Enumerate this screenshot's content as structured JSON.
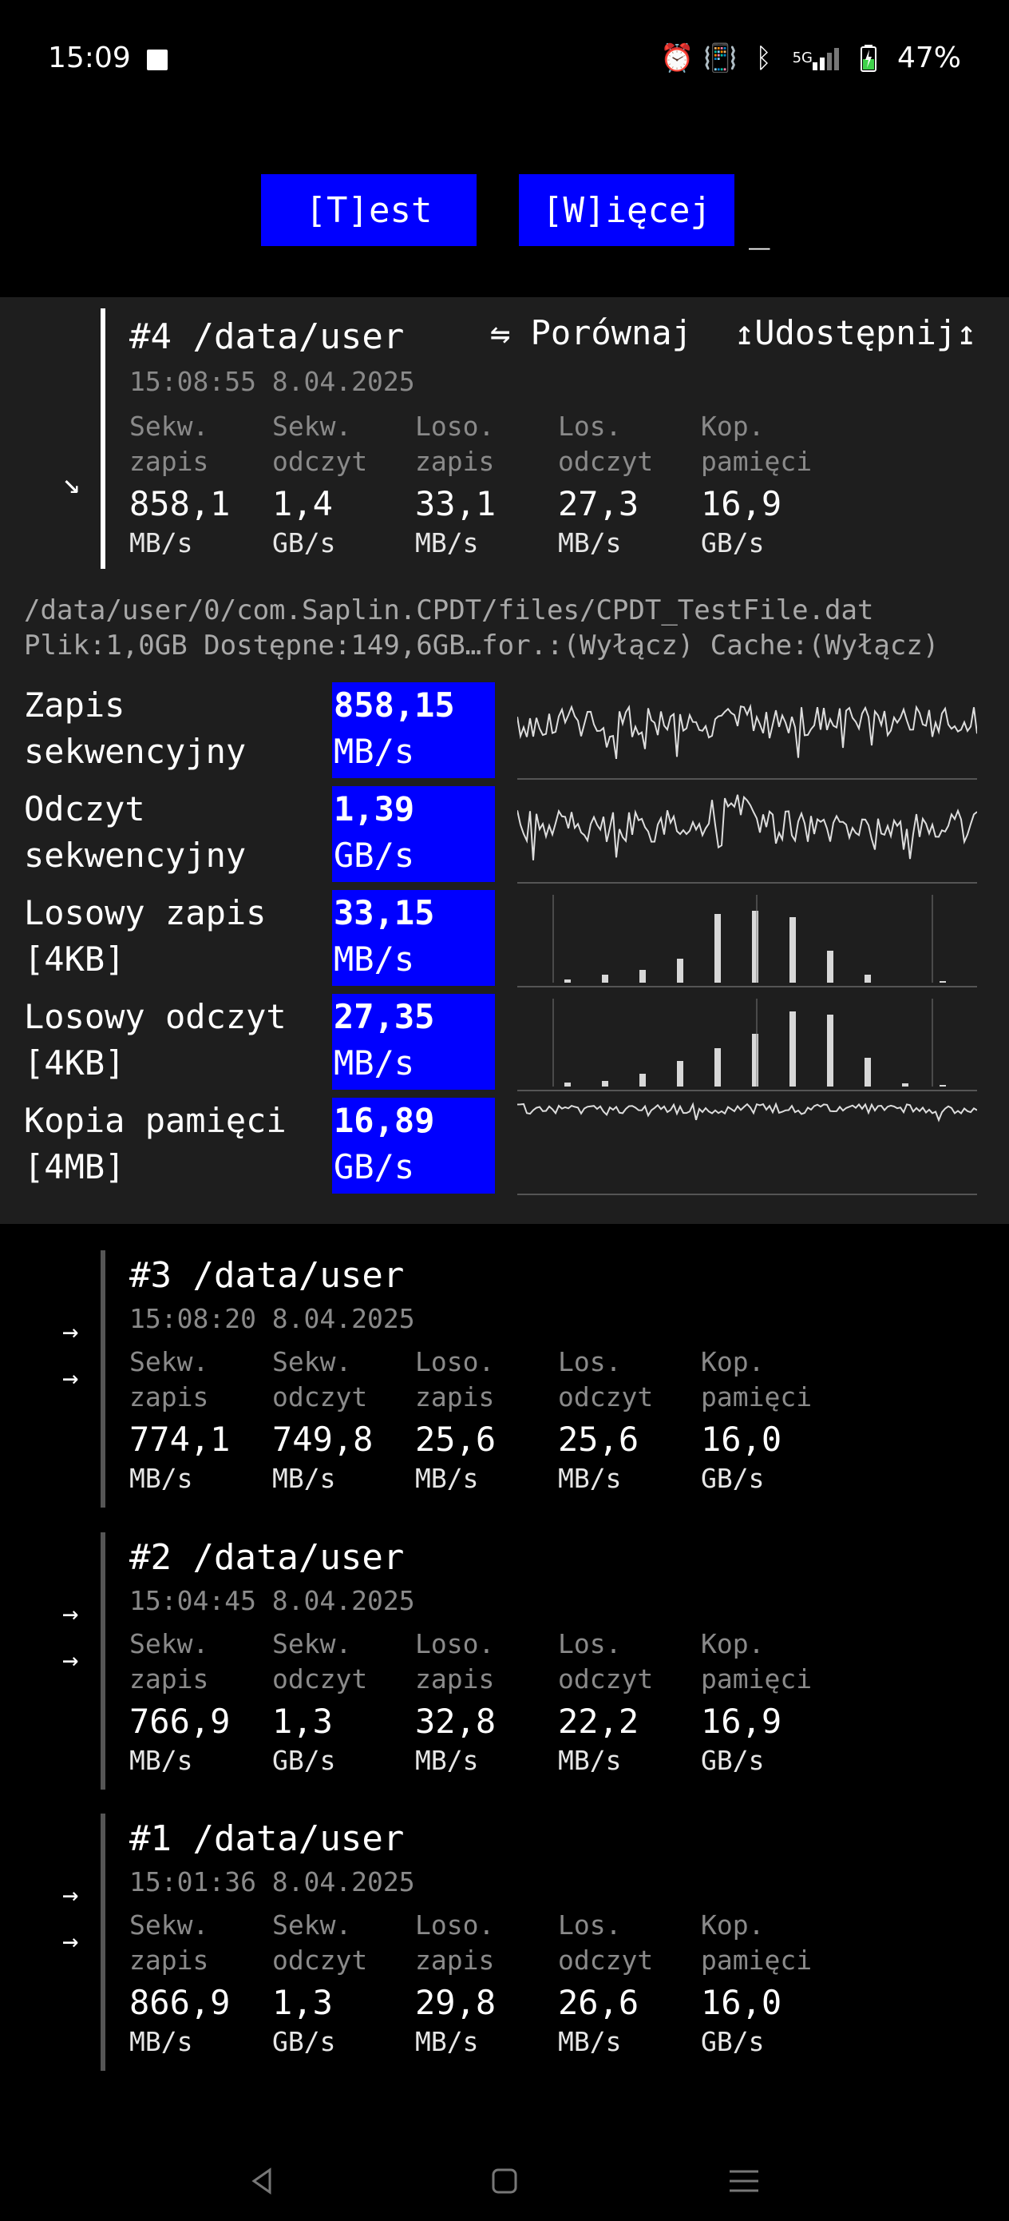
{
  "status": {
    "time": "15:09",
    "battery": "47%",
    "network": "5G"
  },
  "toolbar": {
    "test_label": "[T]est",
    "more_label": "[W]ięcej",
    "cursor": "_"
  },
  "column_headers": [
    {
      "line1": "Sekw.",
      "line2": "zapis"
    },
    {
      "line1": "Sekw.",
      "line2": "odczyt"
    },
    {
      "line1": "Loso.",
      "line2": "zapis"
    },
    {
      "line1": "Los.",
      "line2": "odczyt"
    },
    {
      "line1": "Kop.",
      "line2": "pamięci"
    }
  ],
  "expanded": {
    "title": "#4 /data/user",
    "date": "15:08:55 8.04.2025",
    "arrow": "↘",
    "compare_label": "⇋ Porównaj",
    "share_label": "↥Udostępnij↥",
    "values": [
      {
        "v": "858,1",
        "u": "MB/s"
      },
      {
        "v": "1,4",
        "u": "GB/s"
      },
      {
        "v": "33,1",
        "u": "MB/s"
      },
      {
        "v": "27,3",
        "u": "MB/s"
      },
      {
        "v": "16,9",
        "u": "GB/s"
      }
    ],
    "path": "/data/user/0/com.Saplin.CPDT/files/CPDT_TestFile.dat",
    "info": "Plik:1,0GB Dostępne:149,6GB…for.:(Wyłącz) Cache:(Wyłącz)",
    "metrics": [
      {
        "label": "Zapis\nsekwencyjny",
        "value": "858,15",
        "unit": "MB/s"
      },
      {
        "label": "Odczyt\nsekwencyjny",
        "value": "1,39",
        "unit": "GB/s"
      },
      {
        "label": "Losowy zapis\n[4KB]",
        "value": "33,15",
        "unit": "MB/s"
      },
      {
        "label": "Losowy odczyt\n[4KB]",
        "value": "27,35",
        "unit": "MB/s"
      },
      {
        "label": "Kopia pamięci\n[4MB]",
        "value": "16,89",
        "unit": "GB/s"
      }
    ]
  },
  "results": [
    {
      "title": "#3 /data/user",
      "date": "15:08:20 8.04.2025",
      "arrows": [
        "→",
        "→"
      ],
      "values": [
        {
          "v": "774,1",
          "u": "MB/s"
        },
        {
          "v": "749,8",
          "u": "MB/s"
        },
        {
          "v": "25,6",
          "u": "MB/s"
        },
        {
          "v": "25,6",
          "u": "MB/s"
        },
        {
          "v": "16,0",
          "u": "GB/s"
        }
      ]
    },
    {
      "title": "#2 /data/user",
      "date": "15:04:45 8.04.2025",
      "arrows": [
        "→",
        "→"
      ],
      "values": [
        {
          "v": "766,9",
          "u": "MB/s"
        },
        {
          "v": "1,3",
          "u": "GB/s"
        },
        {
          "v": "32,8",
          "u": "MB/s"
        },
        {
          "v": "22,2",
          "u": "MB/s"
        },
        {
          "v": "16,9",
          "u": "GB/s"
        }
      ]
    },
    {
      "title": "#1 /data/user",
      "date": "15:01:36 8.04.2025",
      "arrows": [
        "→",
        "→"
      ],
      "values": [
        {
          "v": "866,9",
          "u": "MB/s"
        },
        {
          "v": "1,3",
          "u": "GB/s"
        },
        {
          "v": "29,8",
          "u": "MB/s"
        },
        {
          "v": "26,6",
          "u": "MB/s"
        },
        {
          "v": "16,0",
          "u": "GB/s"
        }
      ]
    }
  ],
  "colors": {
    "accent": "#0000ff",
    "panel": "#1e1e1e"
  }
}
